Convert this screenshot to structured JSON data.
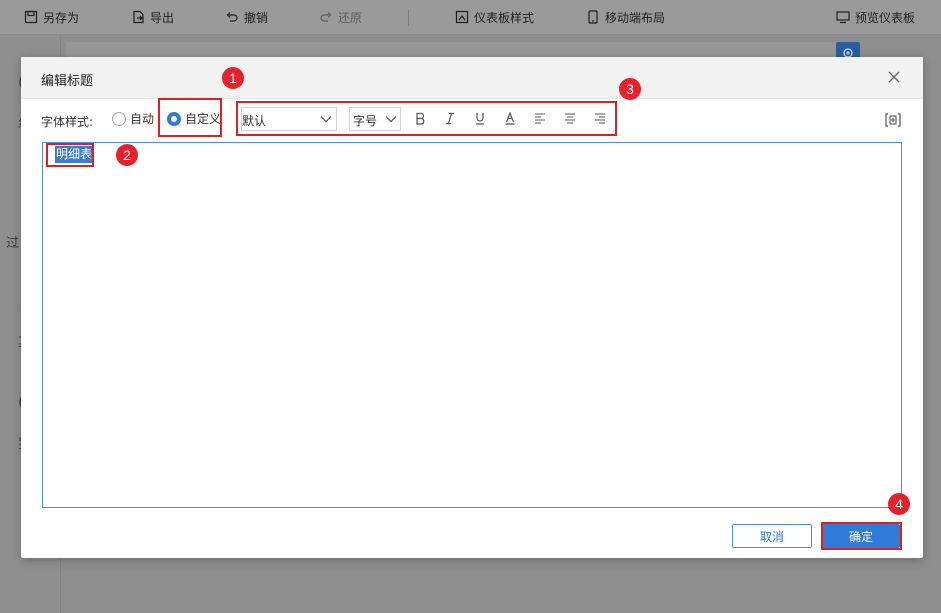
{
  "toolbar": {
    "save_as": "另存为",
    "export": "导出",
    "undo": "撤销",
    "redo": "还原",
    "dashboard_style": "仪表板样式",
    "mobile_layout": "移动端布局",
    "preview": "预览仪表板"
  },
  "background": {
    "glyph_a": "(",
    "glyph_b": "丝",
    "glyph_c": "过",
    "glyph_d": "彳",
    "glyph_e": "其",
    "glyph_f": "(",
    "glyph_g": "罗"
  },
  "dialog": {
    "title": "编辑标题",
    "font_style_label": "字体样式:",
    "radio_auto": "自动",
    "radio_custom": "自定义",
    "selected_mode": "custom",
    "font_family": "默认",
    "font_size": "字号",
    "editor_text": "明细表",
    "cancel": "取消",
    "confirm": "确定"
  },
  "annotations": {
    "badge_1": "1",
    "badge_2": "2",
    "badge_3": "3",
    "badge_4": "4"
  },
  "colors": {
    "accent": "#2e7cd8",
    "annotation": "#e02020"
  }
}
